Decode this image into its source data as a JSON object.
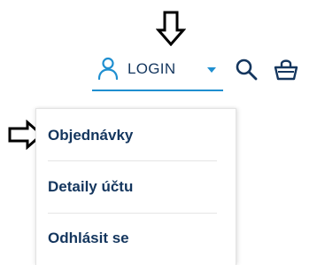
{
  "header": {
    "login_label": "LOGIN",
    "icons": {
      "user": "user-icon",
      "caret": "caret-down-icon",
      "search": "search-icon",
      "cart": "shopping-basket-icon"
    }
  },
  "dropdown": {
    "items": [
      {
        "label": "Objednávky"
      },
      {
        "label": "Detaily účtu"
      },
      {
        "label": "Odhlásit se"
      }
    ]
  },
  "colors": {
    "text": "#14365e",
    "accent": "#1f8fd0",
    "divider": "#e5e5e5"
  }
}
